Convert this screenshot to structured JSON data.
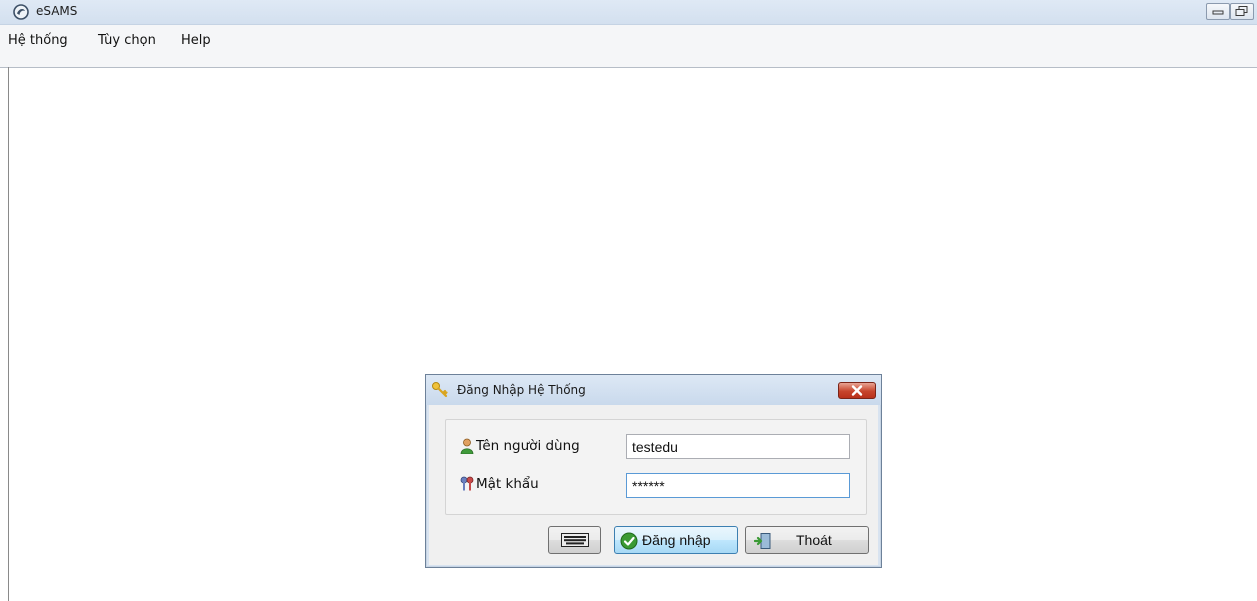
{
  "app": {
    "title": "eSAMS"
  },
  "menu": {
    "items": [
      {
        "label": "Hệ thống"
      },
      {
        "label": "Tùy chọn"
      },
      {
        "label": "Help"
      }
    ]
  },
  "login_dialog": {
    "title": "Đăng Nhập Hệ Thống",
    "username": {
      "label": "Tên người dùng",
      "value": "testedu"
    },
    "password": {
      "label": "Mật khẩu",
      "value": "******"
    },
    "buttons": {
      "keyboard_icon": "keyboard-icon",
      "login_label": "Đăng nhập",
      "exit_label": "Thoát"
    }
  },
  "icons": {
    "app": "globe-icon",
    "dialog": "key-icon",
    "close": "close-icon",
    "user": "user-icon",
    "password": "keys-icon",
    "login": "check-circle-icon",
    "exit": "exit-door-icon"
  },
  "colors": {
    "titlebar": "#d3e0ef",
    "close_button": "#c7442c",
    "login_button_border": "#3c7fb1"
  }
}
